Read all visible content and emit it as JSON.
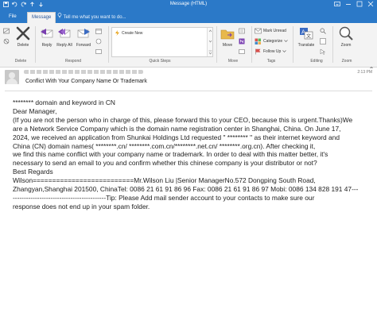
{
  "window": {
    "title": "Message (HTML)"
  },
  "tabs": [
    {
      "label": "File"
    },
    {
      "label": "Message"
    }
  ],
  "tell_me": "Tell me what you want to do...",
  "ribbon": {
    "delete_label": "Delete",
    "reply_label": "Reply",
    "reply_all_label": "Reply All",
    "forward_label": "Forward",
    "quick_steps_item": "Create New",
    "move_label": "Move",
    "mark_unread_label": "Mark Unread",
    "categorize_label": "Categorize",
    "follow_up_label": "Follow Up",
    "translate_label": "Translate",
    "zoom_label": "Zoom",
    "groups": {
      "delete": "Delete",
      "respond": "Respond",
      "quick_steps": "Quick Steps",
      "move": "Move",
      "tags": "Tags",
      "editing": "Editing",
      "zoom": "Zoom"
    }
  },
  "header": {
    "time": "2:13 PM",
    "subject": "Conflict With Your Company Name Or Trademark"
  },
  "body": {
    "lines": [
      "******** domain and keyword in CN",
      "Dear Manager,",
      "(If you are not the person who in charge of this, please forward this to your CEO, because this is urgent.Thanks)We",
      "are a Network Service Company which is the domain name registration center in Shanghai, China. On June 17,",
      "2024, we received an application from Shunkai Holdings Ltd requested \" ******** \" as their internet keyword and",
      "China (CN) domain names( ********.cn/ ********.com.cn/********.net.cn/ ********.org.cn). After checking it,",
      "we find this name conflict with your company name or trademark. In order to deal with this matter better, it's",
      "necessary to send an email to you and confirm whether this chinese company is your distributor or not?",
      "Best Regards",
      "Wilson==========================Mr.Wilson Liu |Senior ManagerNo.572 Dongping South Road,",
      "Zhangyan,Shanghai 201500, ChinaTel: 0086 21 61 91 86 96 Fax: 0086 21 61 91 86 97 Mobi: 0086 134 828 191 47---",
      "------------------------------------------Tip: Please Add mail sender account to your contacts to make sure our",
      "response does not end up in your spam folder."
    ]
  },
  "colors": {
    "titlebar": "#2b79c8",
    "ribbon_bg": "#f3f3f3",
    "delete_x": "#444444",
    "reply_arrow": "#7a3fb0"
  }
}
